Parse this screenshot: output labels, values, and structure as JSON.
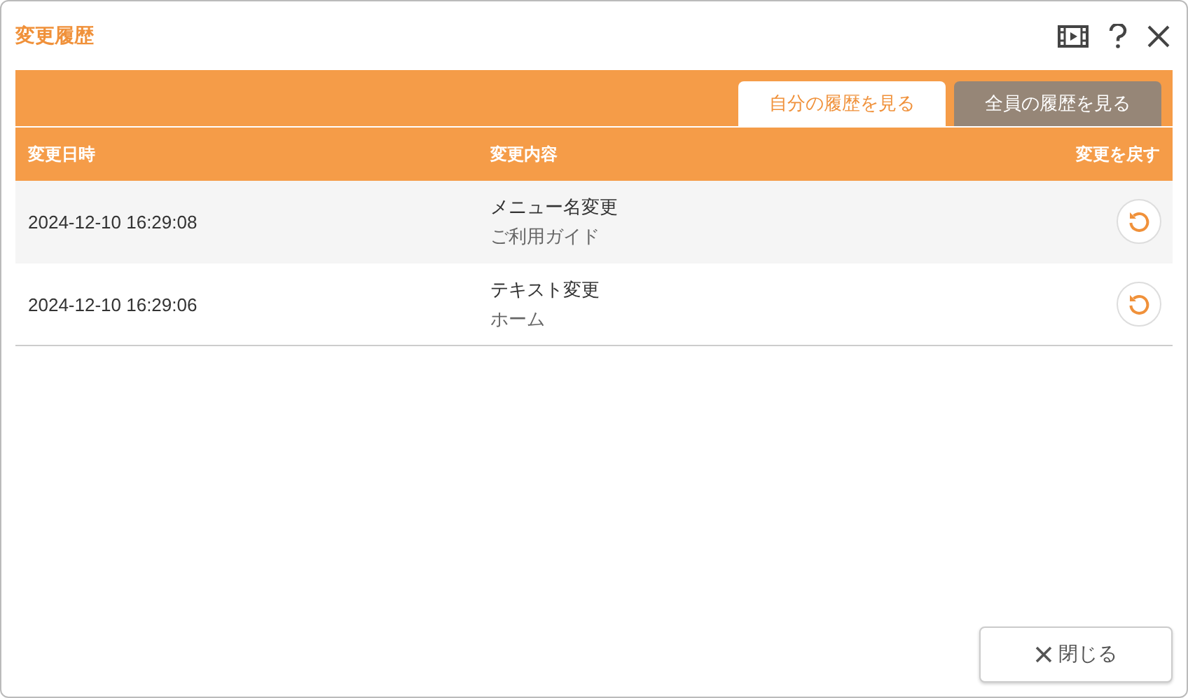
{
  "window": {
    "title": "変更履歴"
  },
  "tabs": [
    {
      "label": "自分の履歴を見る",
      "selected": true
    },
    {
      "label": "全員の履歴を見る",
      "selected": false
    }
  ],
  "table": {
    "columns": [
      "変更日時",
      "変更内容",
      "変更を戻す"
    ],
    "rows": [
      {
        "datetime": "2024-12-10 16:29:08",
        "change": "メニュー名変更",
        "target": "ご利用ガイド",
        "selected": true
      },
      {
        "datetime": "2024-12-10 16:29:06",
        "change": "テキスト変更",
        "target": "ホーム",
        "selected": false
      }
    ]
  },
  "close_button": {
    "label": "閉じる"
  }
}
